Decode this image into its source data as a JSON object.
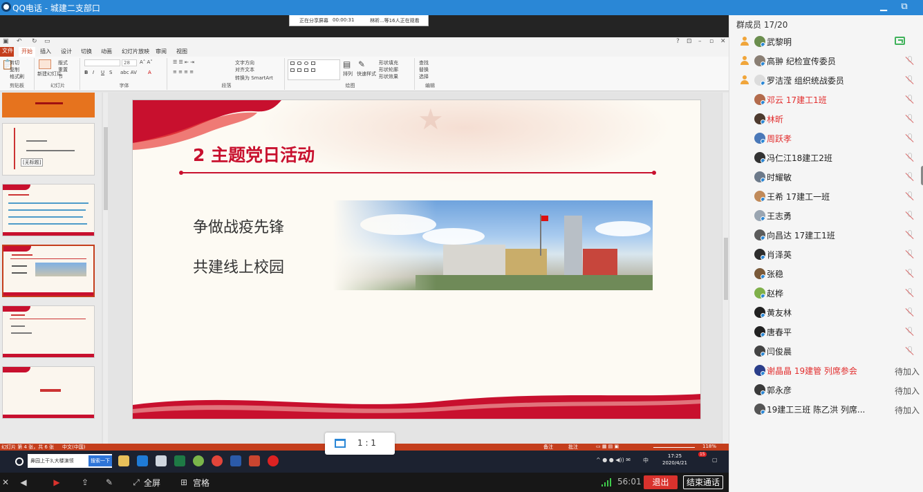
{
  "window": {
    "title": "QQ电话 - 城建二支部口",
    "minimize_glyph": "▁",
    "restore_glyph": "⧉"
  },
  "share_status": {
    "sharing": "正在分享屏幕",
    "elapsed": "00:00:31",
    "viewers": "林昕...等16人正在观看"
  },
  "ppt": {
    "tabs": [
      "文件",
      "开始",
      "插入",
      "设计",
      "切换",
      "动画",
      "幻灯片放映",
      "审阅",
      "视图"
    ],
    "ribbon": {
      "clipboard": {
        "cut": "剪切",
        "copy": "复制",
        "paste_format": "格式刷",
        "group": "剪贴板"
      },
      "slides": {
        "new_slide": "新建幻灯片",
        "layout": "版式",
        "reset": "重置",
        "section": "节",
        "group": "幻灯片"
      },
      "font": {
        "size": "28",
        "group": "字体"
      },
      "paragraph": {
        "text_direction": "文字方向",
        "align_text": "对齐文本",
        "smartart": "转换为 SmartArt",
        "group": "段落"
      },
      "drawing": {
        "arrange": "排列",
        "quick_styles": "快速样式",
        "shape_fill": "形状填充",
        "shape_outline": "形状轮廓",
        "shape_effects": "形状效果",
        "group": "绘图"
      },
      "editing": {
        "find": "查找",
        "replace": "替换",
        "select": "选择",
        "group": "编辑"
      }
    },
    "thumbnails": {
      "thumb2_tooltip": "[无标题]"
    },
    "slide": {
      "title": "2 主题党日活动",
      "lines": [
        "争做战疫先锋",
        "共建线上校园"
      ]
    },
    "status": {
      "slide_info": "幻灯片 第 4 张，共 6 张",
      "language": "中文(中国)",
      "notes": "备注",
      "comments": "批注",
      "zoom": "118%"
    }
  },
  "taskbar": {
    "search_text": "鼻园上干3,大楼演领",
    "search_button": "搜索一下",
    "time": "17:25",
    "date": "2020/4/21",
    "ime": "中",
    "notification_count": "15"
  },
  "zoom_pill": {
    "ratio": "1 : 1"
  },
  "controls": {
    "fullscreen": "全屏",
    "grid": "宫格",
    "duration": "56:01",
    "exit": "退出",
    "end_call": "结束通话"
  },
  "members_header": "群成员 17/20",
  "members": [
    {
      "name": "武黎明",
      "role": "admin",
      "state": "sharing",
      "red": false,
      "avatar_color": "#6b8e4e"
    },
    {
      "name": "高翀 纪检宣传委员",
      "role": "admin",
      "state": "muted",
      "red": false,
      "avatar_color": "#8a7f74"
    },
    {
      "name": "罗洁滢 组织统战委员",
      "role": "admin",
      "state": "muted",
      "red": false,
      "avatar_color": "#dcdcdc"
    },
    {
      "name": "邓云 17建工1班",
      "role": "",
      "state": "muted",
      "red": true,
      "avatar_color": "#b36b4c"
    },
    {
      "name": "林昕",
      "role": "",
      "state": "muted",
      "red": true,
      "avatar_color": "#4d3a2e"
    },
    {
      "name": "周跃孝",
      "role": "",
      "state": "muted",
      "red": true,
      "avatar_color": "#4a78b8"
    },
    {
      "name": "冯仁江18建工2班",
      "role": "",
      "state": "muted",
      "red": false,
      "avatar_color": "#333333"
    },
    {
      "name": "时耀敏",
      "role": "",
      "state": "muted",
      "red": false,
      "avatar_color": "#6d7a8a"
    },
    {
      "name": "王希  17建工一班",
      "role": "",
      "state": "muted",
      "red": false,
      "avatar_color": "#c08a5a"
    },
    {
      "name": "王志勇",
      "role": "",
      "state": "muted",
      "red": false,
      "avatar_color": "#9aa5b1"
    },
    {
      "name": "向昌达 17建工1班",
      "role": "",
      "state": "muted",
      "red": false,
      "avatar_color": "#5c5c5c"
    },
    {
      "name": "肖泽英",
      "role": "",
      "state": "muted",
      "red": false,
      "avatar_color": "#2d2d2d"
    },
    {
      "name": "张稳",
      "role": "",
      "state": "muted",
      "red": false,
      "avatar_color": "#7a5a3a"
    },
    {
      "name": "赵桦",
      "role": "",
      "state": "muted",
      "red": false,
      "avatar_color": "#7fb04a"
    },
    {
      "name": "黄友林",
      "role": "",
      "state": "muted",
      "red": false,
      "avatar_color": "#222222"
    },
    {
      "name": "唐春平",
      "role": "",
      "state": "muted",
      "red": false,
      "avatar_color": "#222222"
    },
    {
      "name": "闫俊晨",
      "role": "",
      "state": "muted",
      "red": false,
      "avatar_color": "#444444"
    },
    {
      "name": "谢晶晶 19建管 列席参会",
      "role": "",
      "state": "waiting",
      "red": true,
      "avatar_color": "#2a3e8a"
    },
    {
      "name": "郭永彦",
      "role": "",
      "state": "waiting",
      "red": false,
      "avatar_color": "#3a3a3a"
    },
    {
      "name": "19建工三班 陈乙洪  列席...",
      "role": "",
      "state": "waiting",
      "red": false,
      "avatar_color": "#555555"
    }
  ],
  "waiting_label": "待加入",
  "colors": {
    "qq_blue": "#2a87d6",
    "ppt_red": "#c43e1c",
    "slide_red": "#c8102e",
    "exit_red": "#d9322d",
    "member_red": "#e22d2d"
  }
}
